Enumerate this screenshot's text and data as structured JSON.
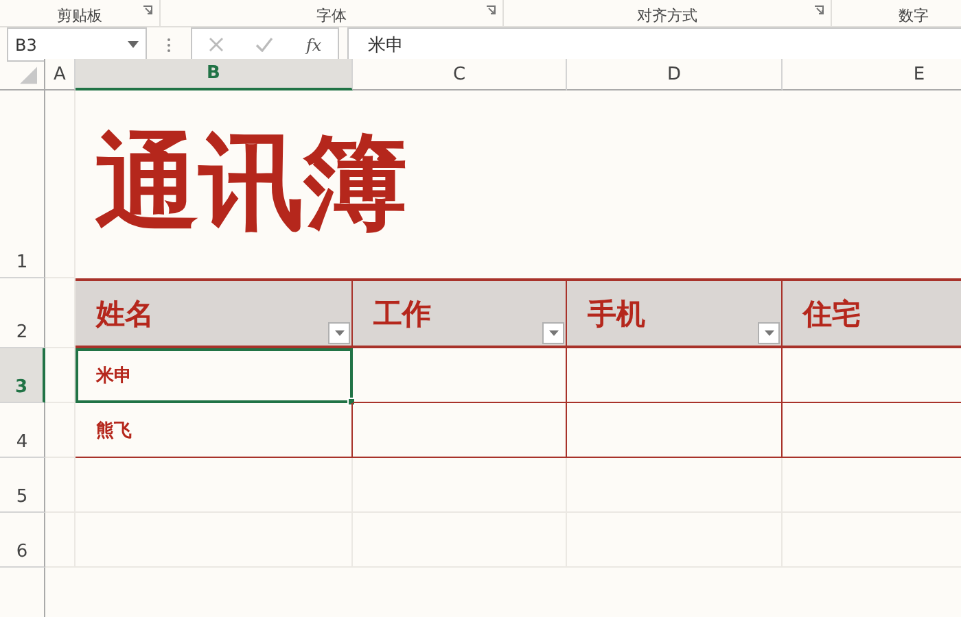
{
  "ribbon": {
    "groups": [
      {
        "label": "剪贴板"
      },
      {
        "label": "字体"
      },
      {
        "label": "对齐方式"
      },
      {
        "label": "数字"
      }
    ]
  },
  "formula_bar": {
    "name_box": "B3",
    "function_button": "fx",
    "value": "米申"
  },
  "columns": [
    {
      "label": "A",
      "selected": false
    },
    {
      "label": "B",
      "selected": true
    },
    {
      "label": "C",
      "selected": false
    },
    {
      "label": "D",
      "selected": false
    },
    {
      "label": "E",
      "selected": false
    }
  ],
  "rows": [
    {
      "label": "1",
      "selected": false
    },
    {
      "label": "2",
      "selected": false
    },
    {
      "label": "3",
      "selected": true
    },
    {
      "label": "4",
      "selected": false
    },
    {
      "label": "5",
      "selected": false
    },
    {
      "label": "6",
      "selected": false
    }
  ],
  "title": "通讯簿",
  "table": {
    "headers": [
      {
        "label": "姓名"
      },
      {
        "label": "工作"
      },
      {
        "label": "手机"
      },
      {
        "label": "住宅"
      }
    ],
    "rows": [
      {
        "name": "米申",
        "selected": true
      },
      {
        "name": "熊飞",
        "selected": false
      }
    ]
  }
}
